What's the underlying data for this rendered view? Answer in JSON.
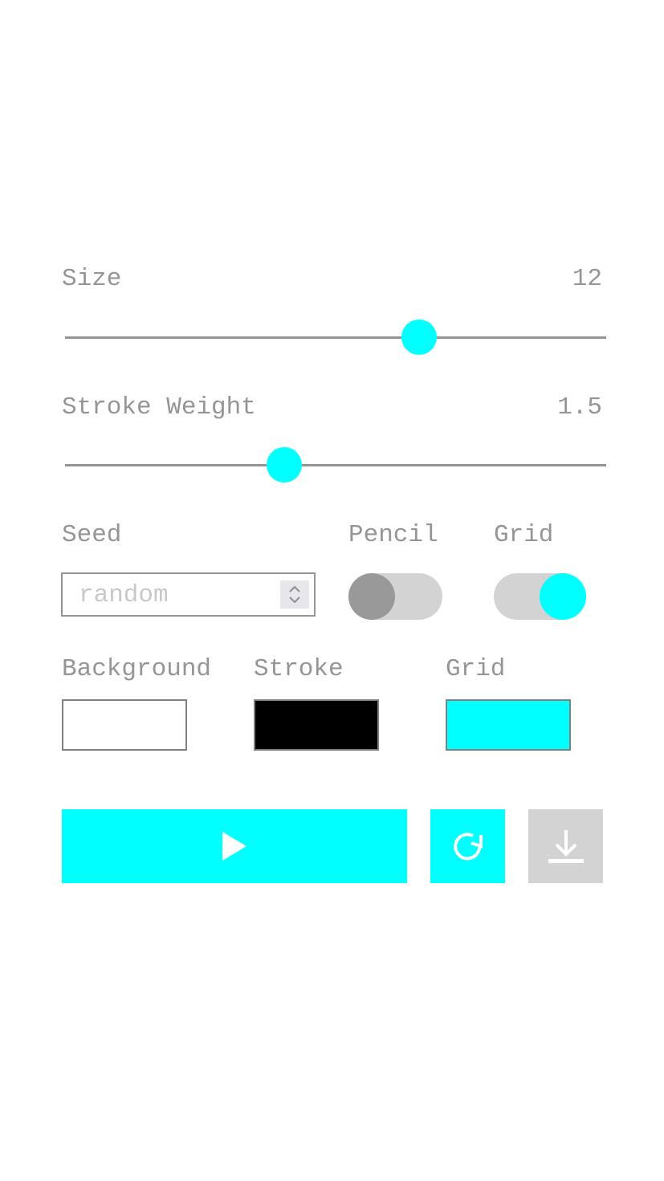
{
  "size": {
    "label": "Size",
    "value": "12",
    "slider_fraction": 0.655
  },
  "stroke_weight": {
    "label": "Stroke Weight",
    "value": "1.5",
    "slider_fraction": 0.405
  },
  "seed": {
    "label": "Seed",
    "placeholder": "random",
    "value": ""
  },
  "pencil": {
    "label": "Pencil",
    "on": false
  },
  "grid_toggle": {
    "label": "Grid",
    "on": true
  },
  "colors": {
    "background": {
      "label": "Background",
      "color": "#ffffff"
    },
    "stroke": {
      "label": "Stroke",
      "color": "#000000"
    },
    "grid": {
      "label": "Grid",
      "color": "#00ffff"
    }
  },
  "buttons": {
    "play": {
      "icon": "play-icon",
      "color": "#00ffff"
    },
    "regenerate": {
      "icon": "refresh-icon",
      "color": "#00ffff"
    },
    "download": {
      "icon": "download-icon",
      "color": "#d3d3d3"
    }
  },
  "accent": "#00ffff"
}
